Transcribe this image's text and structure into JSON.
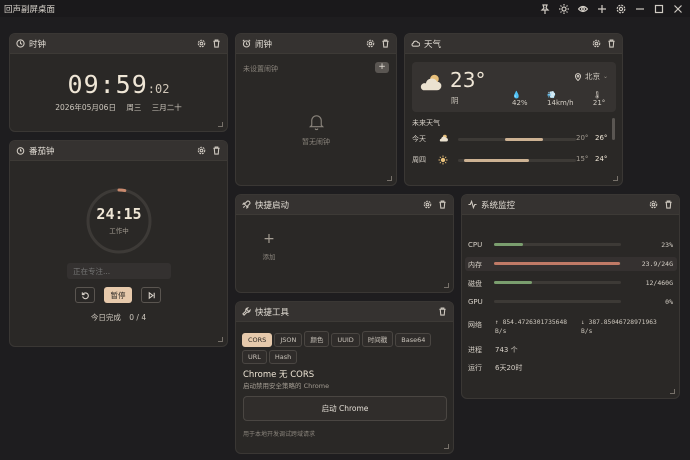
{
  "app": {
    "title": "回声副屏桌面"
  },
  "clock": {
    "title": "时钟",
    "hm": "09:59",
    "sec": ":02",
    "date": "2026年05月06日",
    "weekday": "周三",
    "lunar": "三月二十"
  },
  "alarm": {
    "title": "闹钟",
    "empty_label": "未设置闹钟",
    "none_text": "暂无闹钟",
    "add_label": "+"
  },
  "weather": {
    "title": "天气",
    "temp": "23°",
    "cond": "阴",
    "city": "北京",
    "humidity": "42%",
    "wind": "14km/h",
    "feels": "21°",
    "forecast_title": "未来天气",
    "forecast": [
      {
        "day": "今天",
        "low": "20°",
        "high": "26°",
        "icon": "cloud-icon",
        "range": [
          0.4,
          0.72
        ]
      },
      {
        "day": "周四",
        "low": "15°",
        "high": "24°",
        "icon": "sun-icon",
        "range": [
          0.05,
          0.6
        ]
      }
    ]
  },
  "pomodoro": {
    "title": "番茄钟",
    "time": "24:15",
    "state": "工作中",
    "focus_placeholder": "正在专注...",
    "pause_label": "暂停",
    "today_label": "今日完成",
    "today_count": "0 / 4",
    "progress": 0.03
  },
  "launcher": {
    "title": "快捷启动",
    "add_text": "添加",
    "plus": "+"
  },
  "monitor": {
    "title": "系统监控",
    "rows": [
      {
        "label": "CPU",
        "value": "23%",
        "fill": 0.23,
        "color": "#7a9e6e"
      },
      {
        "label": "内存",
        "value": "23.9/24G",
        "fill": 0.99,
        "color": "#c07a66"
      },
      {
        "label": "磁盘",
        "value": "12/460G",
        "fill": 0.3,
        "color": "#7a9e6e"
      },
      {
        "label": "GPU",
        "value": "0%",
        "fill": 0.0,
        "color": "#7a9e6e"
      }
    ],
    "net_label": "网络",
    "net_up": "↑ 854.4726301735648",
    "net_up_unit": "B/s",
    "net_down": "↓ 387.85046728971963",
    "net_down_unit": "B/s",
    "proc_label": "进程",
    "proc_value": "743 个",
    "uptime_label": "运行",
    "uptime_value": "6天20时"
  },
  "tools": {
    "title": "快捷工具",
    "tabs": [
      "CORS",
      "JSON",
      "颜色",
      "UUID",
      "时间戳",
      "Base64",
      "URL",
      "Hash"
    ],
    "active_index": 0,
    "heading": "Chrome 无 CORS",
    "desc": "启动禁用安全策略的 Chrome",
    "launch_label": "启动 Chrome",
    "note": "用于本地开发调试跨域请求"
  }
}
